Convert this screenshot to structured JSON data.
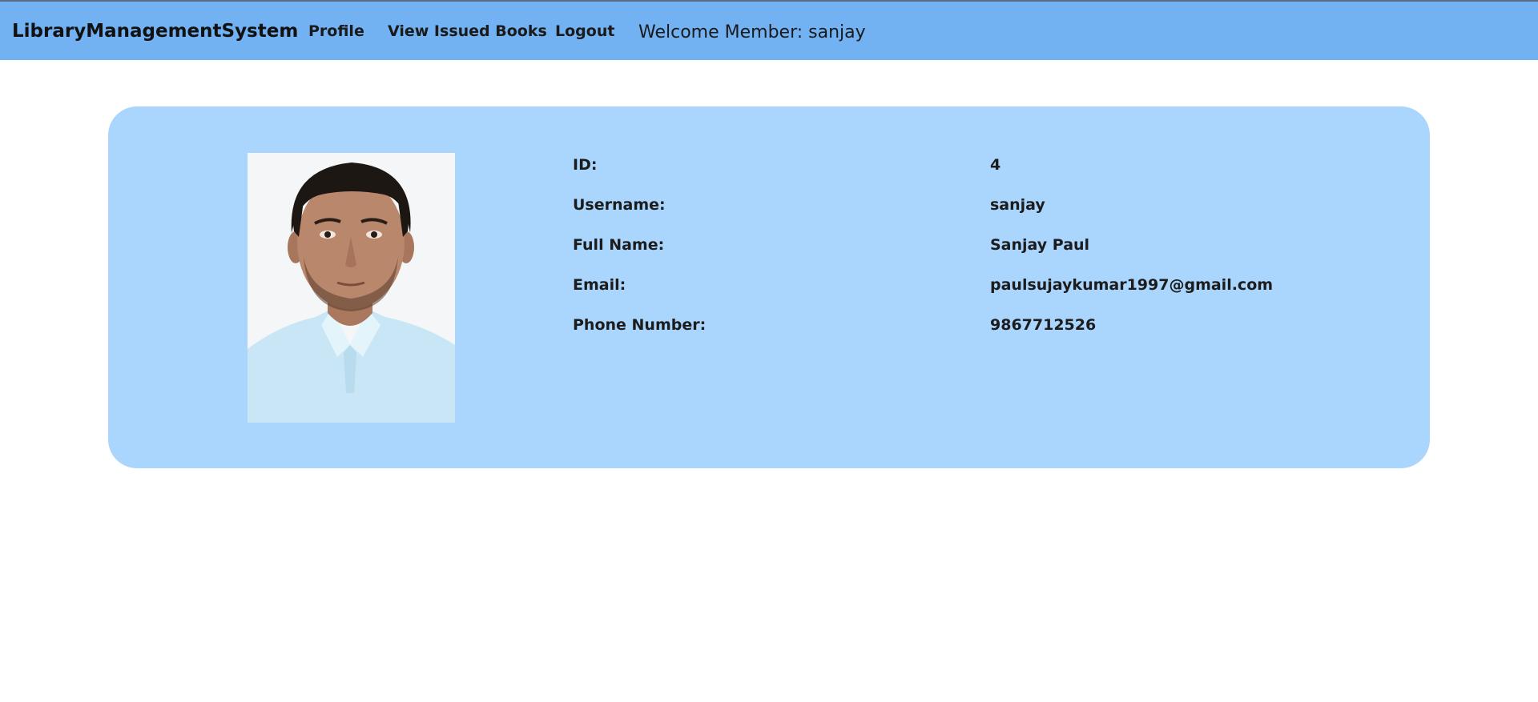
{
  "navbar": {
    "brand": "LibraryManagementSystem",
    "links": [
      "Profile",
      "View Issued Books",
      "Logout"
    ],
    "welcome": "Welcome Member: sanjay",
    "background_color": "#72b1f2"
  },
  "profile": {
    "card_color": "#aad5fd",
    "photo": "member-portrait",
    "details": [
      {
        "label": "ID:",
        "value": "4"
      },
      {
        "label": "Username:",
        "value": "sanjay"
      },
      {
        "label": "Full Name:",
        "value": "Sanjay Paul"
      },
      {
        "label": "Email:",
        "value": "paulsujaykumar1997@gmail.com"
      },
      {
        "label": "Phone Number:",
        "value": "9867712526"
      }
    ]
  }
}
